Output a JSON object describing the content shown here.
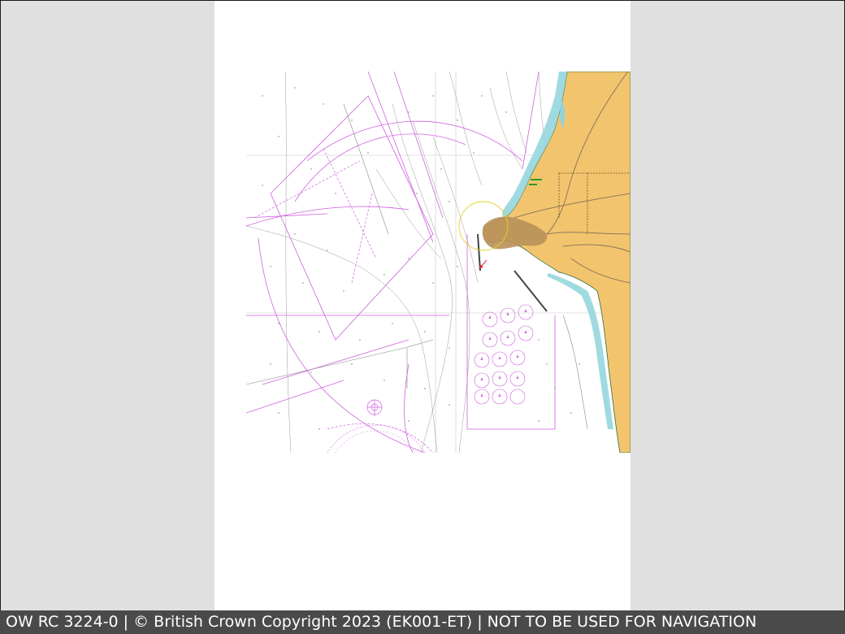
{
  "caption": "OW RC 3224-0 | © British Crown Copyright 2023 (EK001-ET) | NOT TO BE USED FOR NAVIGATION",
  "colors": {
    "background": "#e0e0e0",
    "page": "#ffffff",
    "land": "#f3c46e",
    "built_up": "#b8915a",
    "shallow_water": "#8fd3dc",
    "magenta": "#d060e0",
    "caption_bar": "#4a4a4a"
  },
  "icons": [
    "compass-rose-icon",
    "light-flare-icon",
    "anchorage-icon"
  ]
}
